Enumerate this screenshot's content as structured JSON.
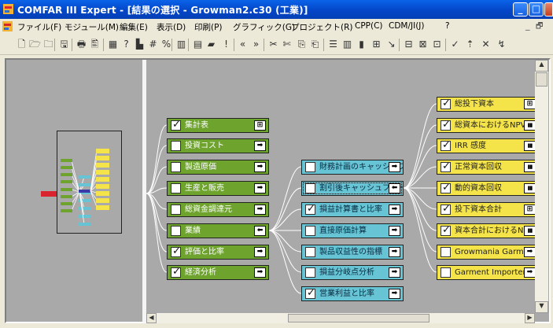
{
  "window": {
    "title": "COMFAR III Expert - [結果の選択 - Growman2.c30 (工業)]",
    "minimize": "_",
    "maximize": "□",
    "close": "✕"
  },
  "menu": {
    "items": [
      "ファイル(F)",
      "モジュール(M)",
      "編集(E)",
      "表示(D)",
      "印刷(P)",
      "グラフィック(G)",
      "プロジェクト(R)",
      "CPP(C)",
      "CDM/JI(J)",
      "?"
    ],
    "mdi_min": "_",
    "mdi_restore": "🗗"
  },
  "toolbar": {
    "icons": [
      "new-file-icon",
      "open-folder-icon",
      "open-icon",
      "save-icon",
      "print-icon",
      "print-preview-icon",
      "table-icon",
      "help-cursor-icon",
      "tools-icon",
      "grid-icon",
      "percent-icon",
      "table2-icon",
      "calculator-icon",
      "folder-yellow-icon",
      "exclamation-icon",
      "link-left-icon",
      "link-right-icon",
      "cut-icon",
      "cut2-icon",
      "copy-icon",
      "paste-icon",
      "list-icon",
      "columns-icon",
      "bars-icon",
      "hierarchy-icon",
      "chart-icon",
      "layout1-icon",
      "layout2-icon",
      "layout3-icon",
      "check-icon",
      "arrow-up-icon",
      "cross-icon",
      "arrow-icon"
    ],
    "glyphs": [
      "🗋",
      "🗁",
      "🗀",
      "🖫",
      "🖶",
      "🖺",
      "▦",
      "?",
      "▙",
      "#",
      "%",
      "▥",
      "▤",
      "▰",
      "!",
      "«",
      "»",
      "✂",
      "✄",
      "⎘",
      "⎗",
      "☰",
      "▥",
      "▮",
      "⊞",
      "↘",
      "⊟",
      "⊠",
      "⊡",
      "✓",
      "⇡",
      "✕",
      "↯"
    ]
  },
  "level1": [
    {
      "label": "集計表",
      "checked": true,
      "action": "table"
    },
    {
      "label": "投資コスト",
      "checked": false,
      "action": "expand"
    },
    {
      "label": "製造原価",
      "checked": false,
      "action": "expand"
    },
    {
      "label": "生産と販売",
      "checked": false,
      "action": "expand"
    },
    {
      "label": "総資金調達元",
      "checked": false,
      "action": "expand"
    },
    {
      "label": "業績",
      "checked": false,
      "action": "collapse"
    },
    {
      "label": "評価と比率",
      "checked": true,
      "action": "expand"
    },
    {
      "label": "経済分析",
      "checked": true,
      "action": "expand"
    }
  ],
  "level2": [
    {
      "label": "財務計画のキャッシュフロ",
      "checked": false,
      "action": "expand"
    },
    {
      "label": "割引後キャッシュフロー",
      "checked": false,
      "action": "collapse",
      "selected": true
    },
    {
      "label": "損益計算書と比率",
      "checked": true,
      "action": "expand"
    },
    {
      "label": "直接原価計算",
      "checked": false,
      "action": "expand"
    },
    {
      "label": "製品収益性の指標",
      "checked": false,
      "action": "expand"
    },
    {
      "label": "損益分岐点分析",
      "checked": false,
      "action": "expand"
    },
    {
      "label": "営業利益と比率",
      "checked": true,
      "action": "expand"
    }
  ],
  "level3": [
    {
      "label": "総投下資本",
      "checked": true,
      "action": "table"
    },
    {
      "label": "総資本におけるNPV",
      "checked": true,
      "action": "chart"
    },
    {
      "label": "IRR 感度",
      "checked": true,
      "action": "chart"
    },
    {
      "label": "正常資本回収",
      "checked": true,
      "action": "chart"
    },
    {
      "label": "動的資本回収",
      "checked": true,
      "action": "chart"
    },
    {
      "label": "投下資本合計",
      "checked": true,
      "action": "table"
    },
    {
      "label": "資本合計におけるNF",
      "checked": true,
      "action": "chart"
    },
    {
      "label": "Growmania Garments",
      "checked": false,
      "action": "expand"
    },
    {
      "label": "Garment Importers, L",
      "checked": false,
      "action": "expand"
    }
  ],
  "colors": {
    "green": "#6ea32e",
    "cyan": "#66c4d4",
    "yellow": "#f4e44a",
    "red": "#d9232e",
    "blue": "#3b3ba8",
    "background": "#a9a9a9"
  }
}
